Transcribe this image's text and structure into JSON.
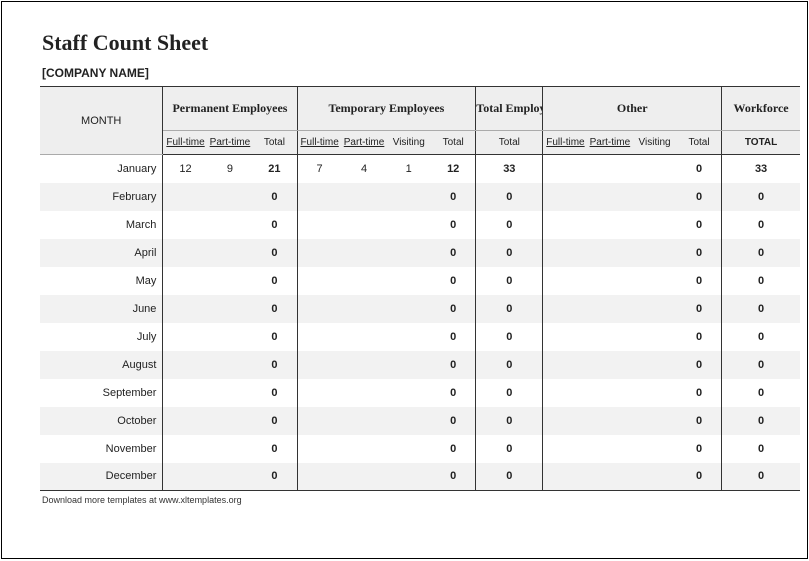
{
  "title": "Staff Count Sheet",
  "company": "[COMPANY NAME]",
  "footer": "Download more templates at www.xltemplates.org",
  "headers": {
    "month": "MONTH",
    "permanent": "Permanent Employees",
    "temporary": "Temporary Employees",
    "totalEmp": "Total Employees",
    "other": "Other",
    "workforce": "Workforce",
    "full": "Full-time",
    "part": "Part-time",
    "visiting": "Visiting",
    "total": "Total",
    "TOTAL": "TOTAL"
  },
  "rows": [
    {
      "month": "January",
      "pf": "12",
      "pp": "9",
      "pt": "21",
      "tf": "7",
      "tp": "4",
      "tv": "1",
      "tt": "12",
      "te": "33",
      "of": "",
      "op": "",
      "ov": "",
      "ot": "0",
      "wf": "33"
    },
    {
      "month": "February",
      "pf": "",
      "pp": "",
      "pt": "0",
      "tf": "",
      "tp": "",
      "tv": "",
      "tt": "0",
      "te": "0",
      "of": "",
      "op": "",
      "ov": "",
      "ot": "0",
      "wf": "0"
    },
    {
      "month": "March",
      "pf": "",
      "pp": "",
      "pt": "0",
      "tf": "",
      "tp": "",
      "tv": "",
      "tt": "0",
      "te": "0",
      "of": "",
      "op": "",
      "ov": "",
      "ot": "0",
      "wf": "0"
    },
    {
      "month": "April",
      "pf": "",
      "pp": "",
      "pt": "0",
      "tf": "",
      "tp": "",
      "tv": "",
      "tt": "0",
      "te": "0",
      "of": "",
      "op": "",
      "ov": "",
      "ot": "0",
      "wf": "0"
    },
    {
      "month": "May",
      "pf": "",
      "pp": "",
      "pt": "0",
      "tf": "",
      "tp": "",
      "tv": "",
      "tt": "0",
      "te": "0",
      "of": "",
      "op": "",
      "ov": "",
      "ot": "0",
      "wf": "0"
    },
    {
      "month": "June",
      "pf": "",
      "pp": "",
      "pt": "0",
      "tf": "",
      "tp": "",
      "tv": "",
      "tt": "0",
      "te": "0",
      "of": "",
      "op": "",
      "ov": "",
      "ot": "0",
      "wf": "0"
    },
    {
      "month": "July",
      "pf": "",
      "pp": "",
      "pt": "0",
      "tf": "",
      "tp": "",
      "tv": "",
      "tt": "0",
      "te": "0",
      "of": "",
      "op": "",
      "ov": "",
      "ot": "0",
      "wf": "0"
    },
    {
      "month": "August",
      "pf": "",
      "pp": "",
      "pt": "0",
      "tf": "",
      "tp": "",
      "tv": "",
      "tt": "0",
      "te": "0",
      "of": "",
      "op": "",
      "ov": "",
      "ot": "0",
      "wf": "0"
    },
    {
      "month": "September",
      "pf": "",
      "pp": "",
      "pt": "0",
      "tf": "",
      "tp": "",
      "tv": "",
      "tt": "0",
      "te": "0",
      "of": "",
      "op": "",
      "ov": "",
      "ot": "0",
      "wf": "0"
    },
    {
      "month": "October",
      "pf": "",
      "pp": "",
      "pt": "0",
      "tf": "",
      "tp": "",
      "tv": "",
      "tt": "0",
      "te": "0",
      "of": "",
      "op": "",
      "ov": "",
      "ot": "0",
      "wf": "0"
    },
    {
      "month": "November",
      "pf": "",
      "pp": "",
      "pt": "0",
      "tf": "",
      "tp": "",
      "tv": "",
      "tt": "0",
      "te": "0",
      "of": "",
      "op": "",
      "ov": "",
      "ot": "0",
      "wf": "0"
    },
    {
      "month": "December",
      "pf": "",
      "pp": "",
      "pt": "0",
      "tf": "",
      "tp": "",
      "tv": "",
      "tt": "0",
      "te": "0",
      "of": "",
      "op": "",
      "ov": "",
      "ot": "0",
      "wf": "0"
    }
  ]
}
